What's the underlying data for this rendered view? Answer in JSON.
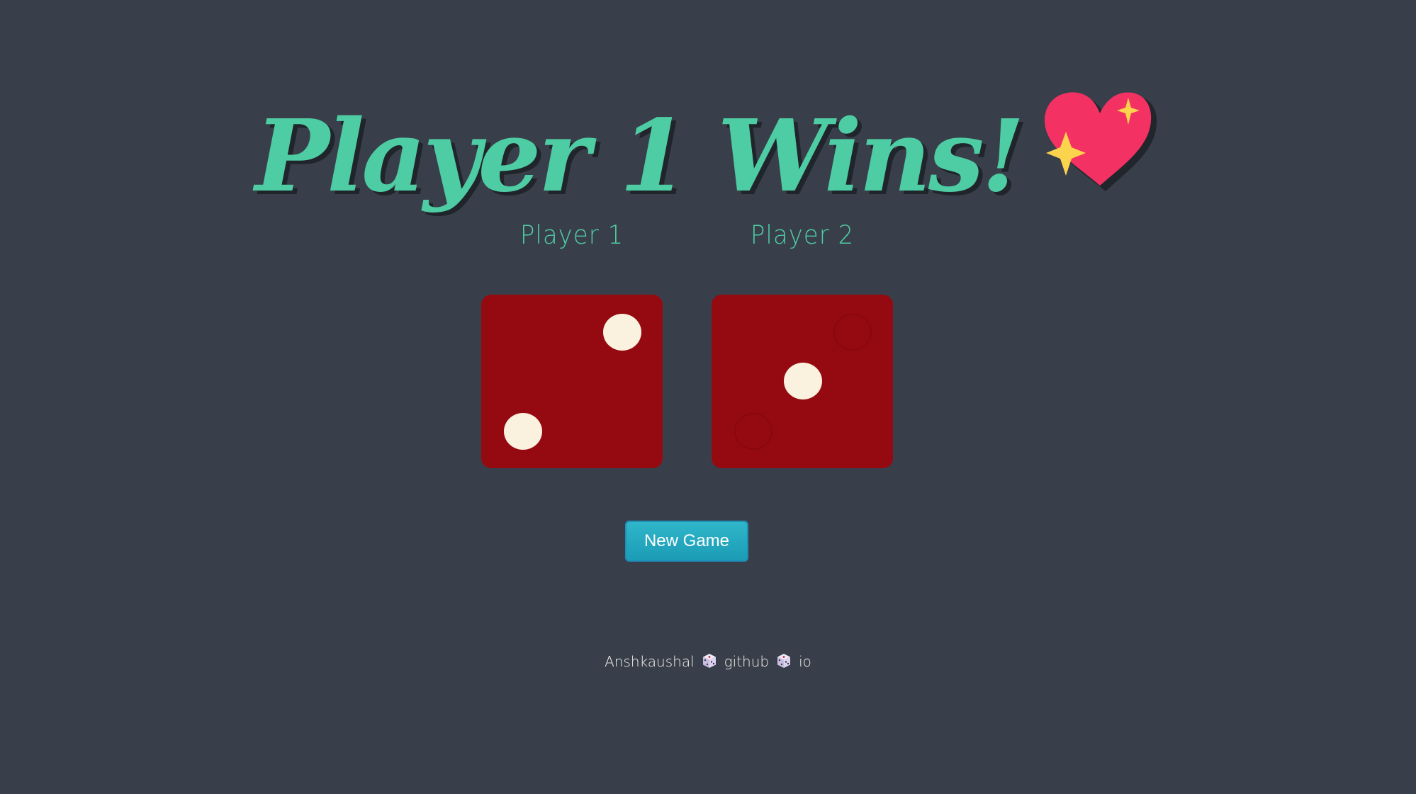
{
  "header": {
    "title": "Player 1 Wins!",
    "title_icon": "sparkling-heart-icon"
  },
  "players": [
    {
      "label": "Player 1",
      "die_value": 2
    },
    {
      "label": "Player 2",
      "die_value": 1
    }
  ],
  "controls": {
    "new_game_label": "New Game"
  },
  "footer": {
    "parts": [
      "Anshkaushal",
      "github",
      "io"
    ],
    "separator_icon": "game-die-icon"
  },
  "colors": {
    "background": "#393f4a",
    "accent": "#4ecca3",
    "die": "#950a10",
    "pip": "#fbf1df",
    "button": "#1b9cb6"
  }
}
